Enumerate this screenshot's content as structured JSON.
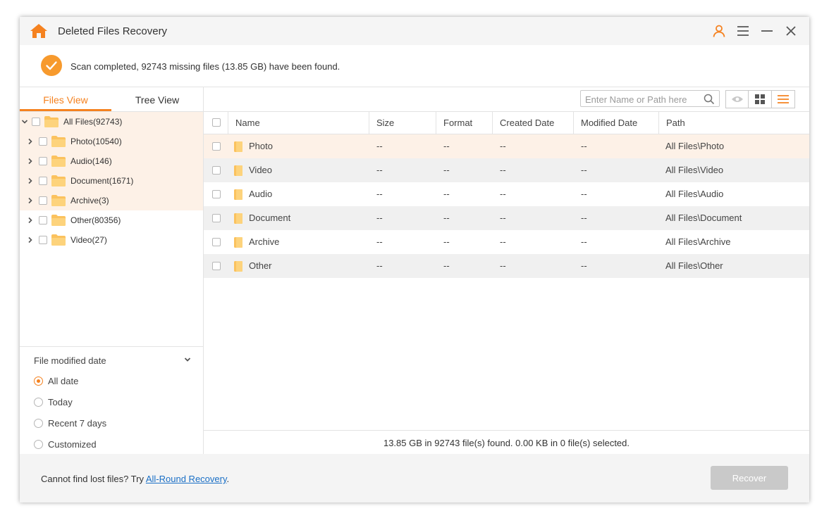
{
  "app": {
    "title": "Deleted Files Recovery",
    "accent_color": "#f58220"
  },
  "banner": {
    "message": "Scan completed, 92743 missing files (13.85 GB) have been found."
  },
  "tabs": [
    {
      "label": "Files View",
      "active": true
    },
    {
      "label": "Tree View",
      "active": false
    }
  ],
  "tree": {
    "root": {
      "label": "All Files(92743)"
    },
    "items": [
      {
        "label": "Photo(10540)"
      },
      {
        "label": "Audio(146)"
      },
      {
        "label": "Document(1671)"
      },
      {
        "label": "Archive(3)"
      },
      {
        "label": "Other(80356)"
      },
      {
        "label": "Video(27)"
      }
    ]
  },
  "filter": {
    "title": "File modified date",
    "options": [
      {
        "label": "All date",
        "selected": true
      },
      {
        "label": "Today",
        "selected": false
      },
      {
        "label": "Recent 7 days",
        "selected": false
      },
      {
        "label": "Customized",
        "selected": false
      }
    ]
  },
  "search": {
    "placeholder": "Enter Name or Path here",
    "value": ""
  },
  "table": {
    "columns": [
      "Name",
      "Size",
      "Format",
      "Created Date",
      "Modified Date",
      "Path"
    ],
    "rows": [
      {
        "name": "Photo",
        "size": "--",
        "format": "--",
        "created": "--",
        "modified": "--",
        "path": "All Files\\Photo"
      },
      {
        "name": "Video",
        "size": "--",
        "format": "--",
        "created": "--",
        "modified": "--",
        "path": "All Files\\Video"
      },
      {
        "name": "Audio",
        "size": "--",
        "format": "--",
        "created": "--",
        "modified": "--",
        "path": "All Files\\Audio"
      },
      {
        "name": "Document",
        "size": "--",
        "format": "--",
        "created": "--",
        "modified": "--",
        "path": "All Files\\Document"
      },
      {
        "name": "Archive",
        "size": "--",
        "format": "--",
        "created": "--",
        "modified": "--",
        "path": "All Files\\Archive"
      },
      {
        "name": "Other",
        "size": "--",
        "format": "--",
        "created": "--",
        "modified": "--",
        "path": "All Files\\Other"
      }
    ]
  },
  "status": {
    "text": "13.85 GB in 92743 file(s) found. 0.00 KB in 0 file(s) selected."
  },
  "footer": {
    "prefix": "Cannot find lost files? Try ",
    "link": "All-Round Recovery",
    "suffix": ".",
    "recover_label": "Recover"
  }
}
